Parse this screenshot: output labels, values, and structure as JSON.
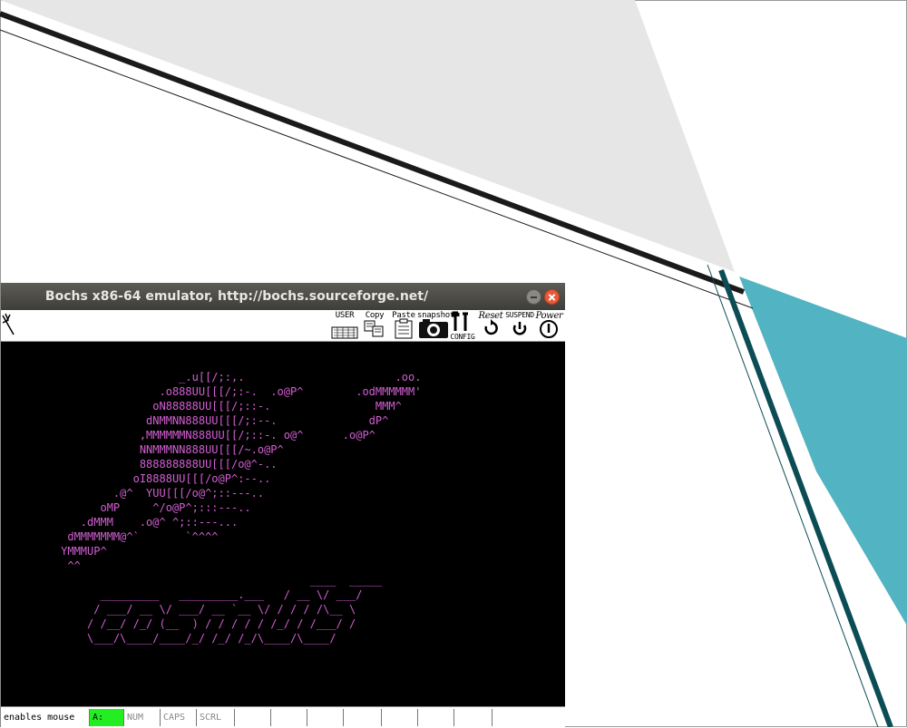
{
  "window": {
    "title": "Bochs x86-64 emulator, http://bochs.sourceforge.net/"
  },
  "toolbar": {
    "user": "USER",
    "copy": "Copy",
    "paste": "Paste",
    "snapshot": "snapshot",
    "config": "CONFIG",
    "reset": "Reset",
    "suspend": "SUSPEND",
    "power": "Power"
  },
  "screen": {
    "art": "                       _.u[[/;:,.                       .oo.\n                    .o888UU[[[/;:-.  .o@P^        .odMMMMMM'\n                   oN88888UU[[[/;::-.                MMM^\n                  dNMMNN888UU[[[/;:--.              dP^\n                 ,MMMMMMN888UU[[/;::-. o@^      .o@P^\n                 NNMMMNN888UU[[[/~.o@P^\n                 888888888UU[[[/o@^-..\n                oI8888UU[[[/o@P^:--..\n             .@^  YUU[[[/o@^;::---..\n           oMP     ^/o@P^;:::---..\n        .dMMM    .o@^ ^;::---...\n      dMMMMMMM@^`       `^^^^\n     YMMMUP^\n      ^^\n                                           ____  _____\n           _________   _________.___   / __ \\/ ___/\n          / ___/ __ \\/ ___/ __ `__ \\/ / / / /\\__ \\\n         / /__/ /_/ (__  ) / / / / / /_/ / /___/ /\n         \\___/\\____/____/_/ /_/ /_/\\____/\\____/"
  },
  "status": {
    "message": "enables mouse",
    "drive": "A:",
    "num": "NUM",
    "caps": "CAPS",
    "scrl": "SCRL"
  },
  "colors": {
    "teal": "#52b3c2",
    "dark_teal": "#0b4c55",
    "gray_panel": "#e6e6e6",
    "console_magenta": "#d35fd3",
    "drive_led": "#22ee22"
  }
}
